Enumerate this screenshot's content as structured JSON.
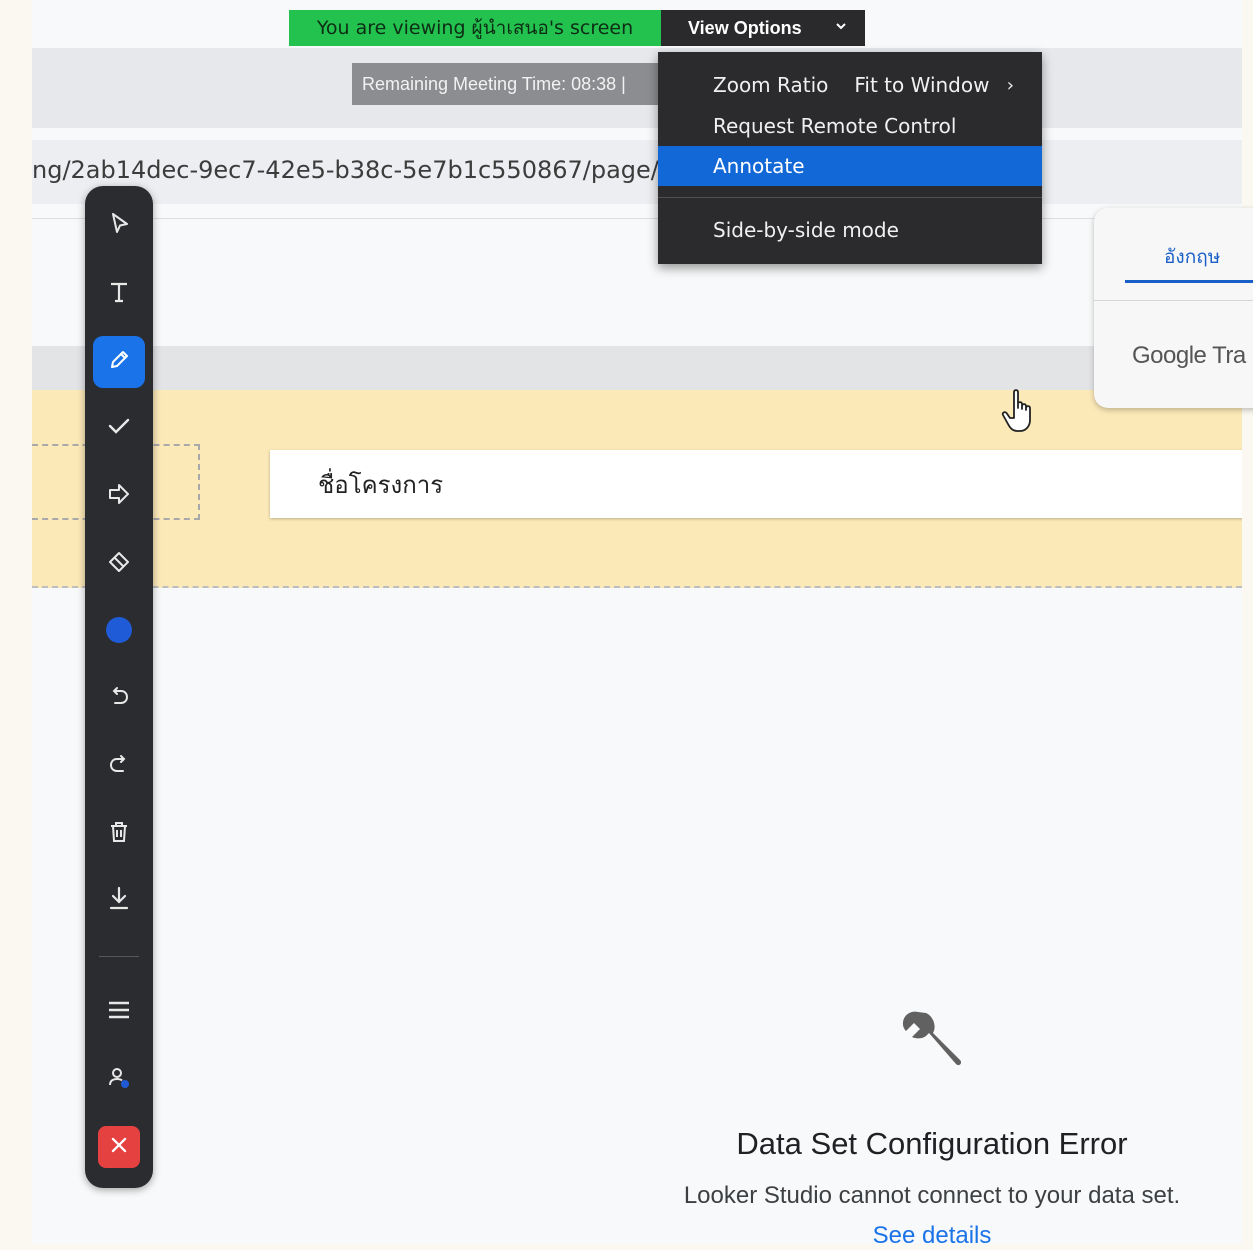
{
  "share_banner": {
    "viewing_text": "You are viewing ผู้นำเสนอ's screen",
    "view_options_label": "View Options",
    "view_options_chevron": "chevron-down-icon"
  },
  "meeting": {
    "remaining_time": "Remaining Meeting Time: 08:38 |"
  },
  "browser": {
    "url_fragment": "ng/2ab14dec-9ec7-42e5-b38c-5e7b1c550867/page/"
  },
  "view_menu": {
    "zoom_ratio_label": "Zoom Ratio",
    "zoom_ratio_value": "Fit to Window",
    "request_remote_control": "Request Remote Control",
    "annotate": "Annotate",
    "side_by_side": "Side-by-side mode"
  },
  "translate_popup": {
    "tab_label": "อังกฤษ",
    "google_text": "Google Tra"
  },
  "report": {
    "title_card_text": "ชื่อโครงการ",
    "error_title": "Data Set Configuration Error",
    "error_desc": "Looker Studio cannot connect to your data set.",
    "error_link": "See details"
  },
  "annotation_toolbar": {
    "tools": [
      "select-icon",
      "text-icon",
      "draw-icon",
      "stamp-icon",
      "spotlight-icon",
      "eraser-icon",
      "color-icon",
      "undo-icon",
      "redo-icon",
      "clear-icon",
      "save-icon",
      "menu-icon",
      "participant-icon",
      "close-icon"
    ],
    "selected_tool": "draw-icon",
    "current_color": "#1f5bd6"
  },
  "colors": {
    "banner_green": "#23c24f",
    "menu_highlight": "#1368d8",
    "toolbar_selected": "#1a73e8",
    "close_red": "#e64141"
  }
}
